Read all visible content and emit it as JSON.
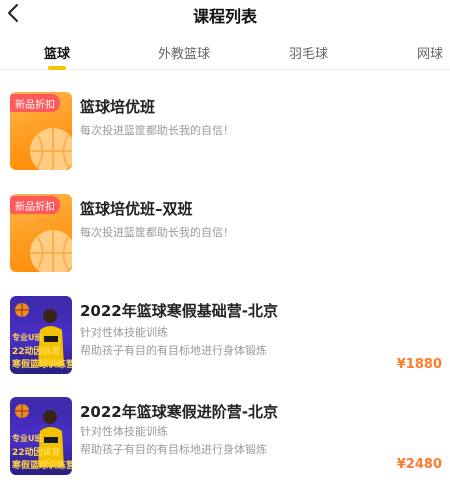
{
  "header": {
    "title": "课程列表"
  },
  "tabs": [
    "篮球",
    "外教篮球",
    "羽毛球",
    "网球"
  ],
  "courses": [
    {
      "title": "篮球培优班",
      "badge": "新品折扣",
      "desc1": "每次投进篮筐都助长我的自信！",
      "desc2": "",
      "price": "",
      "thumb_style": "orange"
    },
    {
      "title": "篮球培优班–双班",
      "badge": "新品折扣",
      "desc1": "每次投进篮筐都助长我的自信！",
      "desc2": "",
      "price": "",
      "thumb_style": "orange"
    },
    {
      "title": "2022年篮球寒假基础营-北京",
      "badge": "",
      "desc1": "针对性体技能训练",
      "desc2": "帮助孩子有目的有目标地进行身体锻炼",
      "price": "¥1880",
      "thumb_style": "purple",
      "promo": {
        "line1": "专业U班",
        "line2": "22动因体育",
        "line3": "寒假篮球训练营"
      }
    },
    {
      "title": "2022年篮球寒假进阶营-北京",
      "badge": "",
      "desc1": "针对性体技能训练",
      "desc2": "帮助孩子有目的有目标地进行身体锻炼",
      "price": "¥2480",
      "thumb_style": "purple",
      "promo": {
        "line1": "专业U班",
        "line2": "22动因体育",
        "line3": "寒假篮球训练营"
      }
    }
  ],
  "colors": {
    "accent": "#f5c400",
    "price": "#ff7a2b",
    "badge": "#ff5a5a"
  },
  "icons": {
    "back": "chevron-left-icon",
    "ball": "basketball-icon"
  }
}
